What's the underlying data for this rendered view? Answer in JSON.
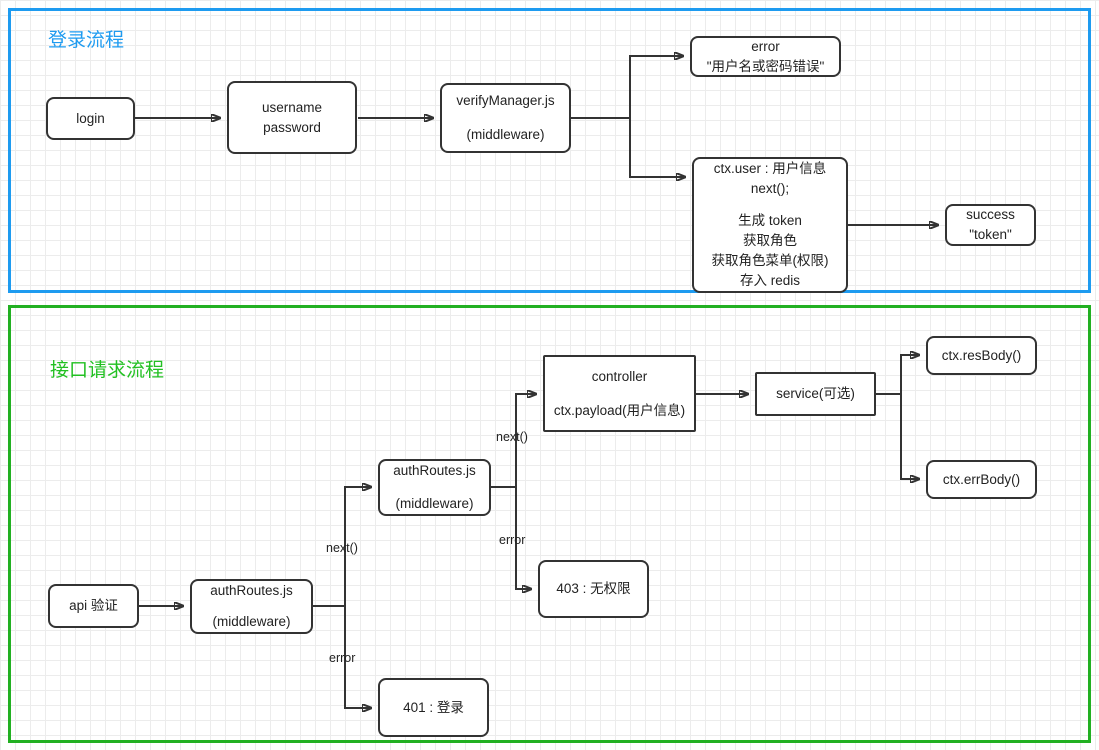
{
  "diagram": {
    "title_login": "登录流程",
    "title_api": "接口请求流程",
    "colors": {
      "login_border": "#1e9bf0",
      "api_border": "#22b022",
      "login_title": "#1e9bf0",
      "api_title": "#22c022",
      "node_border": "#333333",
      "edge": "#333333"
    }
  },
  "login_flow": {
    "nodes": {
      "login": {
        "line1": "login"
      },
      "credentials": {
        "line1": "username",
        "line2": "password"
      },
      "verify_manager": {
        "line1": "verifyManager.js",
        "line2": "(middleware)"
      },
      "error": {
        "line1": "error",
        "line2": "\"用户名或密码错误\""
      },
      "ctx_user": {
        "line1": "ctx.user : 用户信息",
        "line2": "next();",
        "line3": "生成 token",
        "line4": "获取角色",
        "line5": "获取角色菜单(权限)",
        "line6": "存入 redis"
      },
      "success": {
        "line1": "success",
        "line2": "\"token\""
      }
    }
  },
  "api_flow": {
    "nodes": {
      "api_verify": {
        "line1": "api 验证"
      },
      "auth_routes_1": {
        "line1": "authRoutes.js",
        "line2": "(middleware)"
      },
      "auth_routes_2": {
        "line1": "authRoutes.js",
        "line2": "(middleware)"
      },
      "unauthorized_401": {
        "line1": "401 : 登录"
      },
      "forbidden_403": {
        "line1": "403 : 无权限"
      },
      "controller": {
        "line1": "controller",
        "line2": "ctx.payload(用户信息)"
      },
      "service": {
        "line1": "service(可选)"
      },
      "res_body": {
        "line1": "ctx.resBody()"
      },
      "err_body": {
        "line1": "ctx.errBody()"
      }
    },
    "edge_labels": {
      "next_1": "next()",
      "error_1": "error",
      "next_2": "next()",
      "error_2": "error"
    }
  }
}
